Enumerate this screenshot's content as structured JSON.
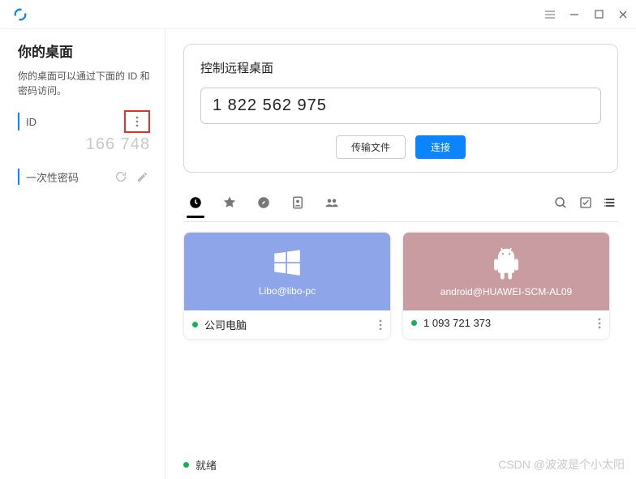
{
  "titlebar": {},
  "sidebar": {
    "title": "你的桌面",
    "desc": "你的桌面可以通过下面的 ID 和密码访问。",
    "id_label": "ID",
    "id_value": "166 748",
    "otp_label": "一次性密码"
  },
  "remote": {
    "title": "控制远程桌面",
    "id_value": "1 822 562 975",
    "transfer_label": "传输文件",
    "connect_label": "连接"
  },
  "devices": [
    {
      "user_at_host": "Libo@libo-pc",
      "display_name": "公司电脑",
      "status": "online",
      "platform": "windows"
    },
    {
      "user_at_host": "android@HUAWEI-SCM-AL09",
      "display_name": "1 093 721 373",
      "status": "online",
      "platform": "android"
    }
  ],
  "status": {
    "ready_label": "就绪"
  },
  "watermark": "CSDN @波波是个小太阳"
}
